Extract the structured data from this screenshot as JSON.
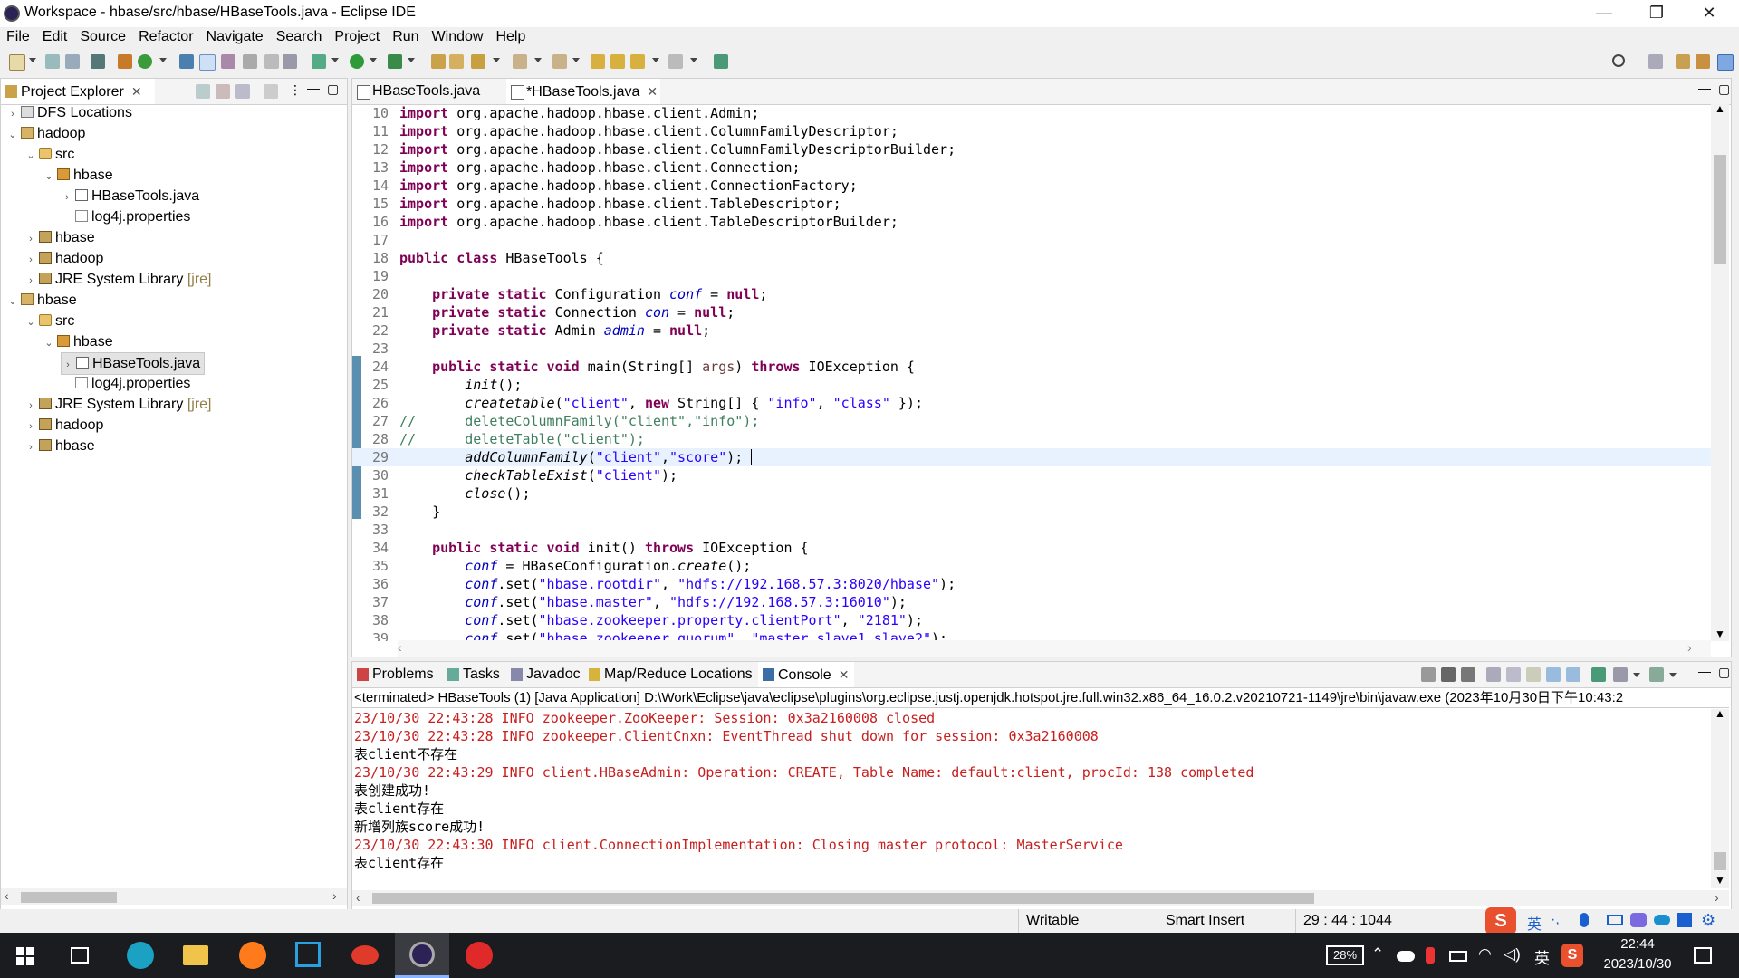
{
  "window": {
    "title": "Workspace - hbase/src/hbase/HBaseTools.java - Eclipse IDE",
    "minimize": "—",
    "maximize": "❐",
    "close": "✕"
  },
  "menu": [
    "File",
    "Edit",
    "Source",
    "Refactor",
    "Navigate",
    "Search",
    "Project",
    "Run",
    "Window",
    "Help"
  ],
  "project_explorer": {
    "title": "Project Explorer",
    "nodes": [
      {
        "label": "DFS Locations",
        "arrow": "›"
      },
      {
        "label": "hadoop",
        "arrow": "⌄"
      },
      {
        "label": "src",
        "arrow": "⌄"
      },
      {
        "label": "hbase",
        "arrow": "⌄"
      },
      {
        "label": "HBaseTools.java",
        "arrow": "›"
      },
      {
        "label": "log4j.properties",
        "arrow": ""
      },
      {
        "label": "hbase",
        "arrow": "›"
      },
      {
        "label": "hadoop",
        "arrow": "›"
      },
      {
        "label": "JRE System Library",
        "suffix": "[jre]",
        "arrow": "›"
      },
      {
        "label": "hbase",
        "arrow": "⌄"
      },
      {
        "label": "src",
        "arrow": "⌄"
      },
      {
        "label": "hbase",
        "arrow": "⌄"
      },
      {
        "label": "HBaseTools.java",
        "arrow": "›"
      },
      {
        "label": "log4j.properties",
        "arrow": ""
      },
      {
        "label": "JRE System Library",
        "suffix": "[jre]",
        "arrow": "›"
      },
      {
        "label": "hadoop",
        "arrow": "›"
      },
      {
        "label": "hbase",
        "arrow": "›"
      }
    ]
  },
  "editor": {
    "tabs": [
      {
        "label": "HBaseTools.java"
      },
      {
        "label": "*HBaseTools.java"
      }
    ],
    "lines": [
      {
        "n": "10",
        "t": "import org.apache.hadoop.hbase.client.Admin;"
      },
      {
        "n": "11",
        "t": "import org.apache.hadoop.hbase.client.ColumnFamilyDescriptor;"
      },
      {
        "n": "12",
        "t": "import org.apache.hadoop.hbase.client.ColumnFamilyDescriptorBuilder;"
      },
      {
        "n": "13",
        "t": "import org.apache.hadoop.hbase.client.Connection;"
      },
      {
        "n": "14",
        "t": "import org.apache.hadoop.hbase.client.ConnectionFactory;"
      },
      {
        "n": "15",
        "t": "import org.apache.hadoop.hbase.client.TableDescriptor;"
      },
      {
        "n": "16",
        "t": "import org.apache.hadoop.hbase.client.TableDescriptorBuilder;"
      },
      {
        "n": "17",
        "t": ""
      },
      {
        "n": "18",
        "t": "public class HBaseTools {"
      },
      {
        "n": "19",
        "t": ""
      },
      {
        "n": "20",
        "t": "    private static Configuration conf = null;"
      },
      {
        "n": "21",
        "t": "    private static Connection con = null;"
      },
      {
        "n": "22",
        "t": "    private static Admin admin = null;"
      },
      {
        "n": "23",
        "t": ""
      },
      {
        "n": "24",
        "t": "    public static void main(String[] args) throws IOException {"
      },
      {
        "n": "25",
        "t": "        init();"
      },
      {
        "n": "26",
        "t": "        createtable(\"client\", new String[] { \"info\", \"class\" });"
      },
      {
        "n": "27",
        "t": "//      deleteColumnFamily(\"client\",\"info\");"
      },
      {
        "n": "28",
        "t": "//      deleteTable(\"client\");"
      },
      {
        "n": "29",
        "t": "        addColumnFamily(\"client\",\"score\");"
      },
      {
        "n": "30",
        "t": "        checkTableExist(\"client\");"
      },
      {
        "n": "31",
        "t": "        close();"
      },
      {
        "n": "32",
        "t": "    }"
      },
      {
        "n": "33",
        "t": ""
      },
      {
        "n": "34",
        "t": "    public static void init() throws IOException {"
      },
      {
        "n": "35",
        "t": "        conf = HBaseConfiguration.create();"
      },
      {
        "n": "36",
        "t": "        conf.set(\"hbase.rootdir\", \"hdfs://192.168.57.3:8020/hbase\");"
      },
      {
        "n": "37",
        "t": "        conf.set(\"hbase.master\", \"hdfs://192.168.57.3:16010\");"
      },
      {
        "n": "38",
        "t": "        conf.set(\"hbase.zookeeper.property.clientPort\", \"2181\");"
      },
      {
        "n": "39",
        "t": "        conf.set(\"hbase.zookeeper.quorum\", \"master,slave1,slave2\");"
      }
    ]
  },
  "bottom": {
    "tabs": [
      "Problems",
      "Tasks",
      "Javadoc",
      "Map/Reduce Locations",
      "Console"
    ],
    "terminated": "<terminated> HBaseTools (1) [Java Application] D:\\Work\\Eclipse\\java\\eclipse\\plugins\\org.eclipse.justj.openjdk.hotspot.jre.full.win32.x86_64_16.0.2.v20210721-1149\\jre\\bin\\javaw.exe  (2023年10月30日下午10:43:2",
    "console": [
      {
        "t": "23/10/30 22:43:28 INFO zookeeper.ZooKeeper: Session: 0x3a2160008 closed",
        "c": "red"
      },
      {
        "t": "23/10/30 22:43:28 INFO zookeeper.ClientCnxn: EventThread shut down for session: 0x3a2160008",
        "c": "red"
      },
      {
        "t": "表client不存在",
        "c": "blk"
      },
      {
        "t": "23/10/30 22:43:29 INFO client.HBaseAdmin: Operation: CREATE, Table Name: default:client, procId: 138 completed",
        "c": "red"
      },
      {
        "t": "表创建成功!",
        "c": "blk"
      },
      {
        "t": "表client存在",
        "c": "blk"
      },
      {
        "t": "新增列族score成功!",
        "c": "blk"
      },
      {
        "t": "23/10/30 22:43:30 INFO client.ConnectionImplementation: Closing master protocol: MasterService",
        "c": "red"
      },
      {
        "t": "表client存在",
        "c": "blk"
      }
    ]
  },
  "status": {
    "writable": "Writable",
    "insert": "Smart Insert",
    "position": "29 : 44 : 1044"
  },
  "taskbar": {
    "battery": "28%",
    "ime": "英",
    "time": "22:44",
    "date": "2023/10/30"
  }
}
